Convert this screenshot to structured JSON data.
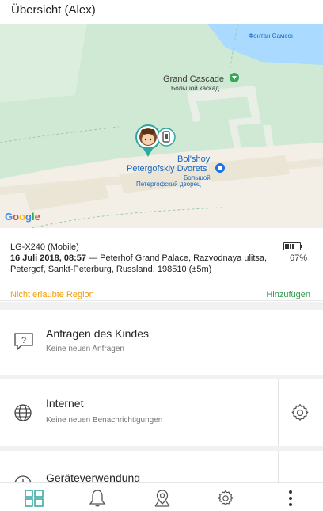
{
  "header": {
    "title": "Übersicht (Alex)"
  },
  "map": {
    "labels": {
      "fontan": "Фонтан Самсон",
      "grand_cascade": "Grand Cascade",
      "grand_cascade_ru": "Большой каскад",
      "palace_line1": "Bol'shoy",
      "palace_line2": "Petergofskiy Dvorets",
      "palace_ru1": "Большой",
      "palace_ru2": "Петергофский дворец",
      "google": "Google"
    },
    "colors": {
      "park": "#cfe9d4",
      "path": "#f3efe6",
      "water": "#aadaff",
      "poi_green": "#34a853",
      "poi_blue": "#1a73e8"
    }
  },
  "device": {
    "name": "LG-X240 (Mobile)",
    "timestamp": "16 Juli 2018, 08:57",
    "location": " — Peterhof Grand Palace, Razvodnaya ulitsa, Petergof, Sankt-Peterburg, Russland, 198510 (±5m)",
    "battery_percent": "67%",
    "battery_level": 0.67
  },
  "links": {
    "region": "Nicht erlaubte Region",
    "add": "Hinzufügen"
  },
  "cards": {
    "requests": {
      "title": "Anfragen des Kindes",
      "subtitle": "Keine neuen Anfragen",
      "icon": "question-bubble-icon"
    },
    "internet": {
      "title": "Internet",
      "subtitle": "Keine neuen Benachrichtigungen",
      "icon": "globe-icon",
      "settings_icon": "gear-icon"
    },
    "device_usage": {
      "title": "Geräteverwendung",
      "icon": "clock-icon"
    }
  },
  "bottom_nav": [
    {
      "name": "dashboard",
      "icon": "grid-icon",
      "active": true
    },
    {
      "name": "notifications",
      "icon": "bell-icon",
      "active": false
    },
    {
      "name": "location",
      "icon": "map-pin-icon",
      "active": false
    },
    {
      "name": "settings",
      "icon": "gear-icon",
      "active": false
    },
    {
      "name": "more",
      "icon": "more-vertical-icon",
      "active": false
    }
  ],
  "accent": "#2fa7a1"
}
